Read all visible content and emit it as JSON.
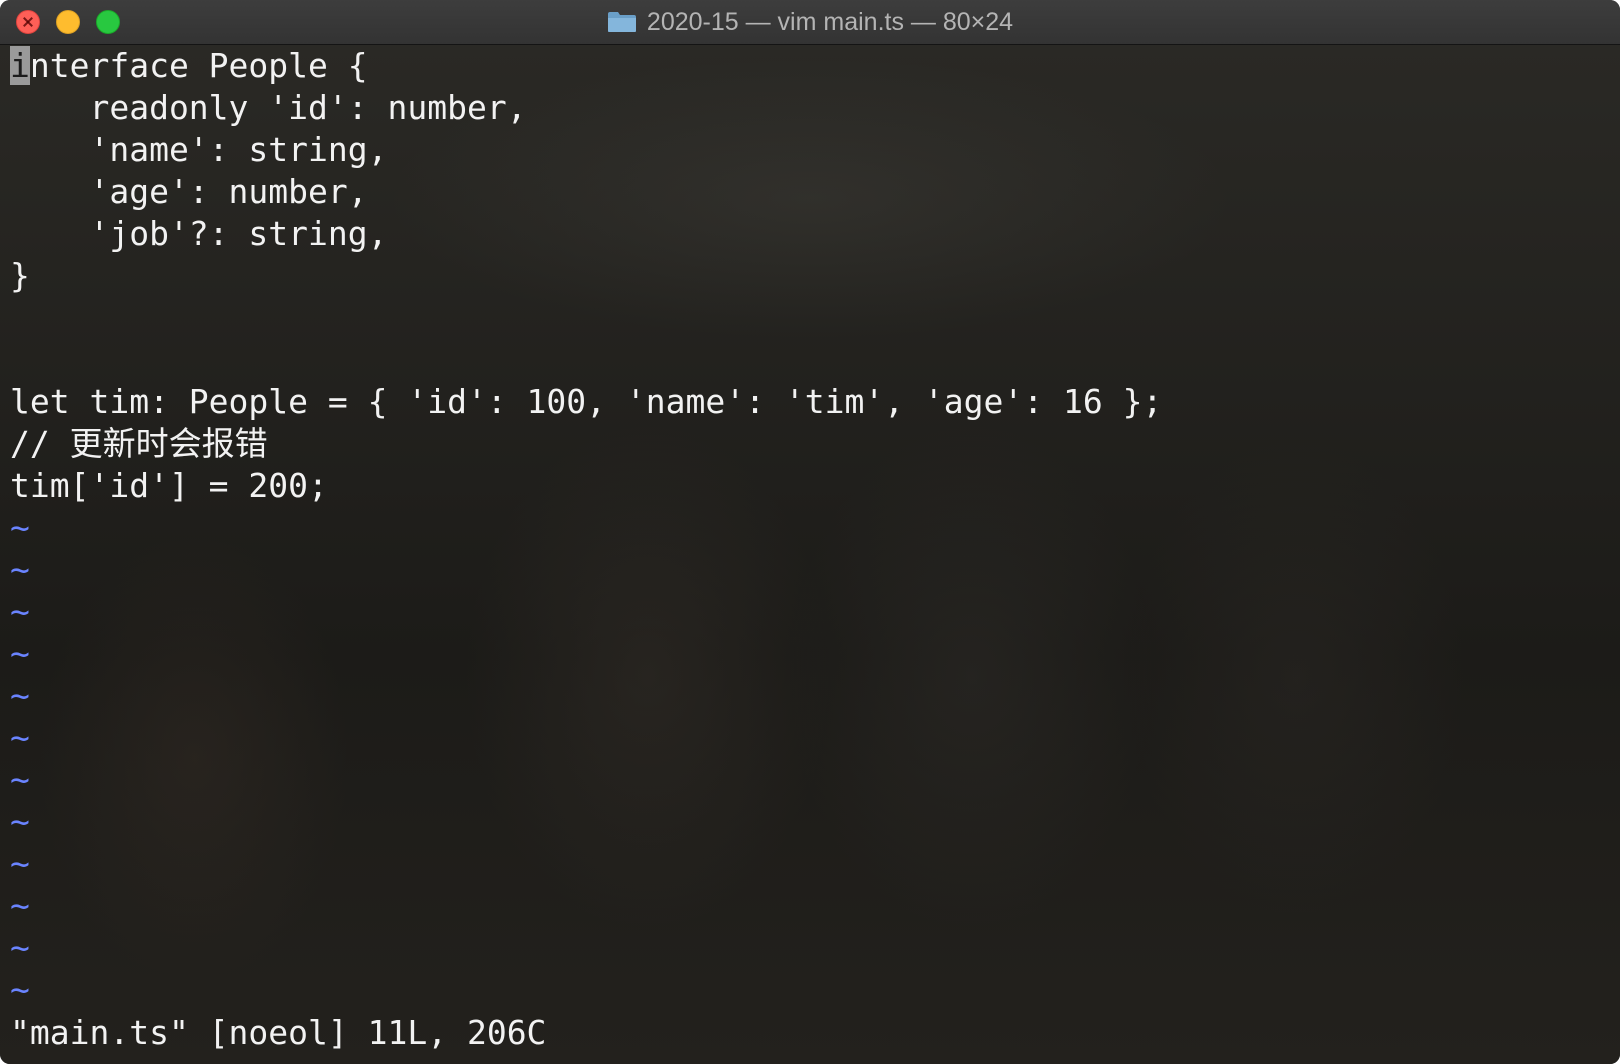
{
  "window": {
    "title": "2020-15 — vim main.ts — 80×24",
    "folder_icon": "folder-icon",
    "colors": {
      "close": "#fe5f57",
      "minimize": "#febc2e",
      "maximize": "#28c840"
    }
  },
  "editor": {
    "cursor_char": "i",
    "lines": [
      "nterface People {",
      "    readonly 'id': number,",
      "    'name': string,",
      "    'age': number,",
      "    'job'?: string,",
      "}",
      "",
      "",
      "let tim: People = { 'id': 100, 'name': 'tim', 'age': 16 };",
      "// 更新时会报错",
      "tim['id'] = 200;"
    ],
    "tilde": "~",
    "tilde_color": "#6a84ff",
    "status": "\"main.ts\" [noeol] 11L, 206C"
  }
}
